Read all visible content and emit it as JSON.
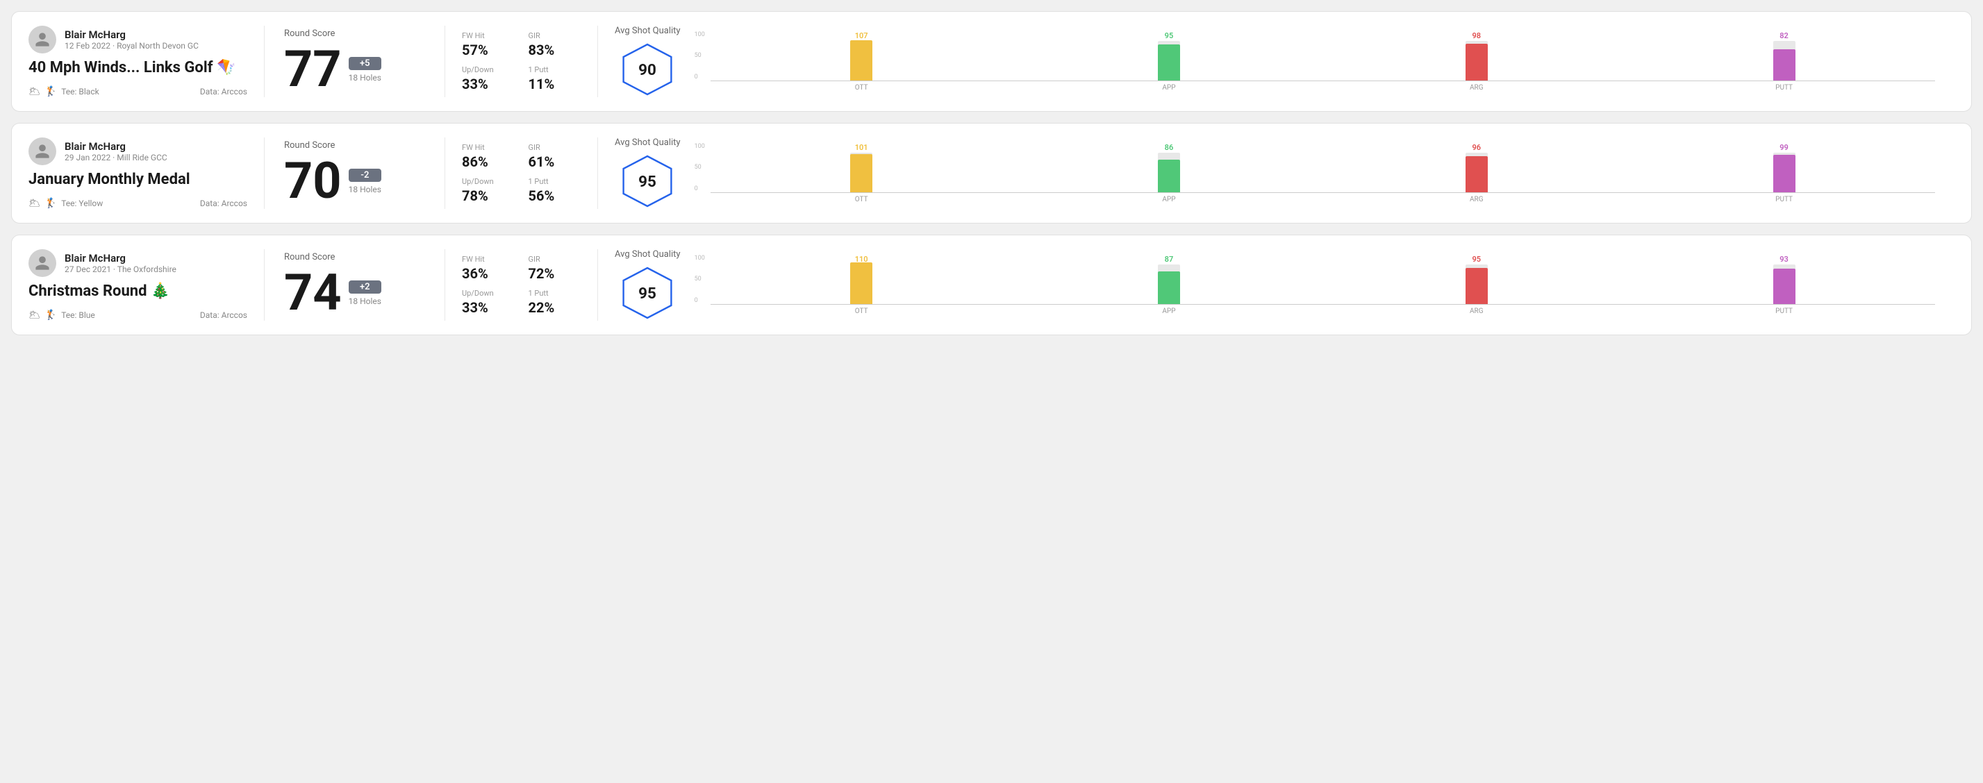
{
  "rounds": [
    {
      "id": "round-1",
      "user_name": "Blair McHarg",
      "user_meta": "12 Feb 2022 · Royal North Devon GC",
      "title": "40 Mph Winds... Links Golf 🪁",
      "tee": "Tee: Black",
      "data_source": "Data: Arccos",
      "round_score_label": "Round Score",
      "score": "77",
      "score_diff": "+5",
      "score_diff_sign": "positive",
      "holes": "18 Holes",
      "fw_hit_label": "FW Hit",
      "fw_hit_value": "57%",
      "gir_label": "GIR",
      "gir_value": "83%",
      "updown_label": "Up/Down",
      "updown_value": "33%",
      "oneputt_label": "1 Putt",
      "oneputt_value": "11%",
      "avg_quality_label": "Avg Shot Quality",
      "quality_score": "90",
      "chart": {
        "max": 100,
        "y_labels": [
          "100",
          "50",
          "0"
        ],
        "bars": [
          {
            "label": "OTT",
            "value": 107,
            "color": "#f0c040"
          },
          {
            "label": "APP",
            "value": 95,
            "color": "#50c878"
          },
          {
            "label": "ARG",
            "value": 98,
            "color": "#e05050"
          },
          {
            "label": "PUTT",
            "value": 82,
            "color": "#c060c0"
          }
        ]
      }
    },
    {
      "id": "round-2",
      "user_name": "Blair McHarg",
      "user_meta": "29 Jan 2022 · Mill Ride GCC",
      "title": "January Monthly Medal",
      "tee": "Tee: Yellow",
      "data_source": "Data: Arccos",
      "round_score_label": "Round Score",
      "score": "70",
      "score_diff": "-2",
      "score_diff_sign": "negative",
      "holes": "18 Holes",
      "fw_hit_label": "FW Hit",
      "fw_hit_value": "86%",
      "gir_label": "GIR",
      "gir_value": "61%",
      "updown_label": "Up/Down",
      "updown_value": "78%",
      "oneputt_label": "1 Putt",
      "oneputt_value": "56%",
      "avg_quality_label": "Avg Shot Quality",
      "quality_score": "95",
      "chart": {
        "max": 100,
        "y_labels": [
          "100",
          "50",
          "0"
        ],
        "bars": [
          {
            "label": "OTT",
            "value": 101,
            "color": "#f0c040"
          },
          {
            "label": "APP",
            "value": 86,
            "color": "#50c878"
          },
          {
            "label": "ARG",
            "value": 96,
            "color": "#e05050"
          },
          {
            "label": "PUTT",
            "value": 99,
            "color": "#c060c0"
          }
        ]
      }
    },
    {
      "id": "round-3",
      "user_name": "Blair McHarg",
      "user_meta": "27 Dec 2021 · The Oxfordshire",
      "title": "Christmas Round 🎄",
      "tee": "Tee: Blue",
      "data_source": "Data: Arccos",
      "round_score_label": "Round Score",
      "score": "74",
      "score_diff": "+2",
      "score_diff_sign": "positive",
      "holes": "18 Holes",
      "fw_hit_label": "FW Hit",
      "fw_hit_value": "36%",
      "gir_label": "GIR",
      "gir_value": "72%",
      "updown_label": "Up/Down",
      "updown_value": "33%",
      "oneputt_label": "1 Putt",
      "oneputt_value": "22%",
      "avg_quality_label": "Avg Shot Quality",
      "quality_score": "95",
      "chart": {
        "max": 100,
        "y_labels": [
          "100",
          "50",
          "0"
        ],
        "bars": [
          {
            "label": "OTT",
            "value": 110,
            "color": "#f0c040"
          },
          {
            "label": "APP",
            "value": 87,
            "color": "#50c878"
          },
          {
            "label": "ARG",
            "value": 95,
            "color": "#e05050"
          },
          {
            "label": "PUTT",
            "value": 93,
            "color": "#c060c0"
          }
        ]
      }
    }
  ]
}
